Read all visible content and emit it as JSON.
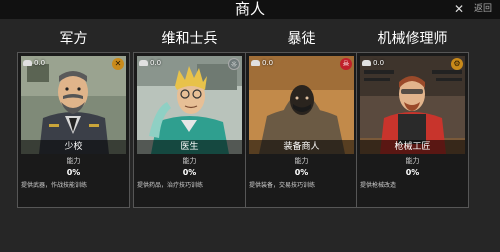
{
  "window": {
    "title": "商人",
    "back_label": "返回",
    "close_glyph": "✕"
  },
  "merchants": [
    {
      "name": "军方",
      "rating": "0.0",
      "role": "少校",
      "ability_label": "能力",
      "ability_value": "0%",
      "description": "提供武器，作战技能训练",
      "badge_icon": "crossed-tools-icon",
      "badge_color": "#c98a1a"
    },
    {
      "name": "维和士兵",
      "rating": "0.0",
      "role": "医生",
      "ability_label": "能力",
      "ability_value": "0%",
      "description": "提供药品，治疗技巧训练",
      "badge_icon": "emblem-icon",
      "badge_color": "#6f7a7a"
    },
    {
      "name": "暴徒",
      "rating": "0.0",
      "role": "装备商人",
      "ability_label": "能力",
      "ability_value": "0%",
      "description": "提供装备，交易技巧训练",
      "badge_icon": "skull-icon",
      "badge_color": "#c0202a"
    },
    {
      "name": "机械修理师",
      "rating": "0.0",
      "role": "枪械工匠",
      "ability_label": "能力",
      "ability_value": "0%",
      "description": "提供枪械改造",
      "badge_icon": "gear-icon",
      "badge_color": "#c98a1a"
    }
  ]
}
